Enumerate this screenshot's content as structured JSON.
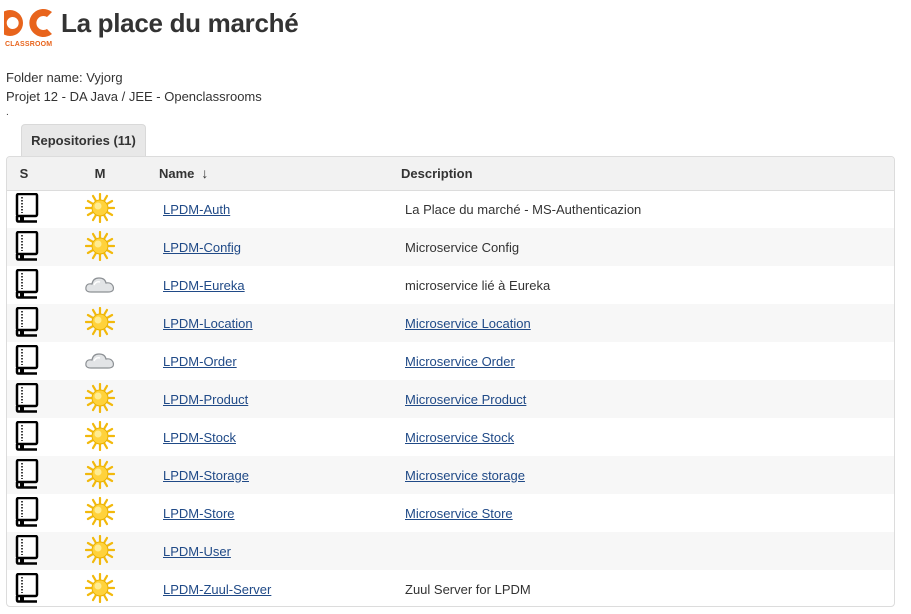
{
  "header": {
    "logo_caption": "CLASSROOM",
    "title": "La place du marché"
  },
  "meta": {
    "folder_line": "Folder name: Vyjorg",
    "project_line": "Projet 12 - DA Java / JEE - Openclassrooms",
    "dot": "."
  },
  "tab": {
    "label": "Repositories (11)"
  },
  "table": {
    "headers": {
      "s": "S",
      "m": "M",
      "name": "Name",
      "desc": "Description",
      "sort_arrow": "↓"
    },
    "rows": [
      {
        "name": "LPDM-Auth",
        "weather": "sun-icon",
        "description": "La Place du marché - MS-Authenticazion",
        "desc_link": false
      },
      {
        "name": "LPDM-Config",
        "weather": "sun-icon",
        "description": "Microservice Config",
        "desc_link": false
      },
      {
        "name": "LPDM-Eureka",
        "weather": "cloud-icon",
        "description": "microservice lié à Eureka",
        "desc_link": false
      },
      {
        "name": "LPDM-Location",
        "weather": "sun-icon",
        "description": "Microservice Location",
        "desc_link": true
      },
      {
        "name": "LPDM-Order",
        "weather": "cloud-icon",
        "description": "Microservice Order",
        "desc_link": true
      },
      {
        "name": "LPDM-Product",
        "weather": "sun-icon",
        "description": "Microservice Product",
        "desc_link": true
      },
      {
        "name": "LPDM-Stock",
        "weather": "sun-icon",
        "description": "Microservice Stock",
        "desc_link": true
      },
      {
        "name": "LPDM-Storage",
        "weather": "sun-icon",
        "description": "Microservice storage",
        "desc_link": true
      },
      {
        "name": "LPDM-Store",
        "weather": "sun-icon",
        "description": "Microservice Store",
        "desc_link": true
      },
      {
        "name": "LPDM-User",
        "weather": "sun-icon",
        "description": "",
        "desc_link": false
      },
      {
        "name": "LPDM-Zuul-Server",
        "weather": "sun-icon",
        "description": "Zuul Server for LPDM",
        "desc_link": false
      }
    ]
  },
  "colors": {
    "brand": "#e8641c",
    "link": "#204a87",
    "header_bg": "#f2f2f2"
  }
}
